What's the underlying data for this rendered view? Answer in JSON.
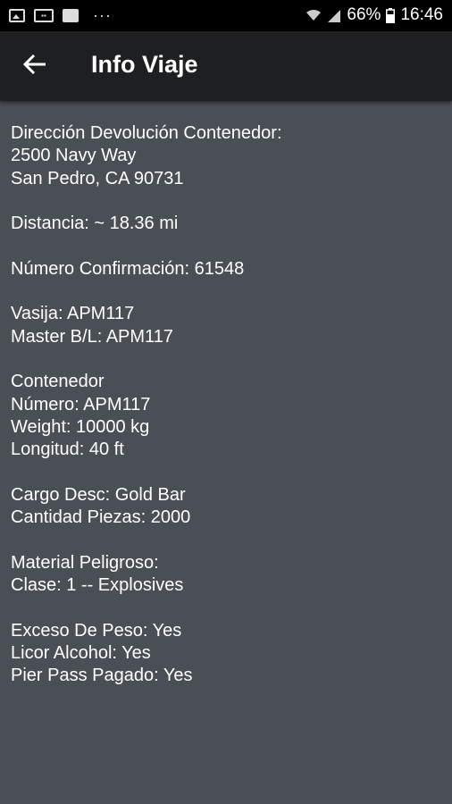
{
  "status_bar": {
    "battery": "66%",
    "time": "16:46",
    "dots": "···"
  },
  "app_bar": {
    "title": "Info Viaje",
    "back_icon": "arrow-back-icon"
  },
  "info": {
    "address_label": "Dirección Devolución Contenedor:",
    "address_line1": "2500 Navy Way",
    "address_line2": "San Pedro, CA 90731",
    "distance": "Distancia: ~ 18.36 mi",
    "confirmation": "Número Confirmación: 61548",
    "vessel": "Vasija: APM117",
    "master_bl": "Master B/L: APM117",
    "container_heading": "Contenedor",
    "container_number": "Número: APM117",
    "weight": "Weight: 10000 kg",
    "length": "Longitud: 40 ft",
    "cargo_desc": "Cargo Desc: Gold Bar",
    "piece_count": "Cantidad Piezas: 2000",
    "hazmat_label": "Material Peligroso:",
    "hazmat_class": "Clase: 1 -- Explosives",
    "overweight": "Exceso De Peso: Yes",
    "liquor": "Licor Alcohol: Yes",
    "pier_pass": "Pier Pass Pagado: Yes"
  }
}
